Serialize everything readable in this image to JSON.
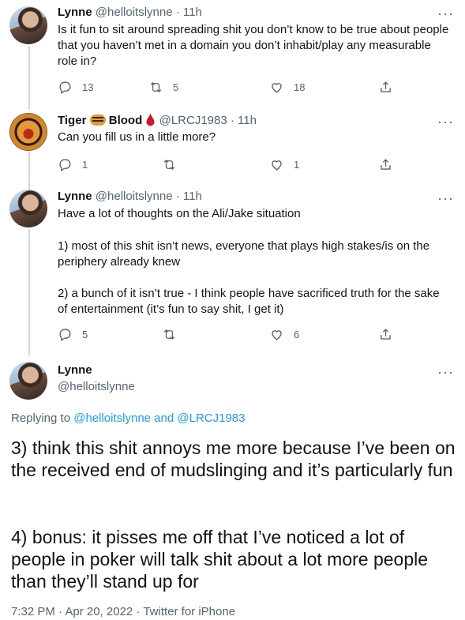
{
  "tweets": [
    {
      "name": "Lynne",
      "handle": "@helloitslynne",
      "time": "11h",
      "text": "Is it fun to sit around spreading shit you don’t know to be true about people that you haven’t met in a domain you don’t inhabit/play any measurable role in?",
      "replies": "13",
      "retweets": "5",
      "likes": "18"
    },
    {
      "name_part1": "Tiger",
      "name_part2": "Blood",
      "handle": "@LRCJ1983",
      "time": "11h",
      "text": "Can you fill us in a little more?",
      "replies": "1",
      "retweets": "",
      "likes": "1"
    },
    {
      "name": "Lynne",
      "handle": "@helloitslynne",
      "time": "11h",
      "text_line1": "Have a lot of thoughts on the Ali/Jake situation",
      "text_para2": "1) most of this shit isn’t news, everyone that plays high stakes/is on the periphery already knew",
      "text_para3": "2) a bunch of it isn’t true - I think people have sacrificed truth for the sake of entertainment (it’s fun to say shit, I get it)",
      "replies": "5",
      "retweets": "",
      "likes": "6"
    }
  ],
  "main_tweet": {
    "name": "Lynne",
    "handle": "@helloitslynne",
    "replying_prefix": "Replying to ",
    "replying_user1": "@helloitslynne",
    "replying_and": " and ",
    "replying_user2": "@LRCJ1983",
    "para1": "3) think this shit annoys me more because I’ve been on the received end of mudslinging and it’s particularly fun",
    "para2": "4) bonus: it pisses me off that I’ve noticed a lot of people in poker will talk shit about a lot more people than they’ll stand up for",
    "timestamp": "7:32 PM · Apr 20, 2022 · Twitter for iPhone"
  },
  "separator": "·",
  "more_glyph": "···",
  "colors": {
    "link": "#1d9bf0",
    "muted": "#536471",
    "thread_line": "#cfd9de",
    "drop": "#d2142a"
  }
}
